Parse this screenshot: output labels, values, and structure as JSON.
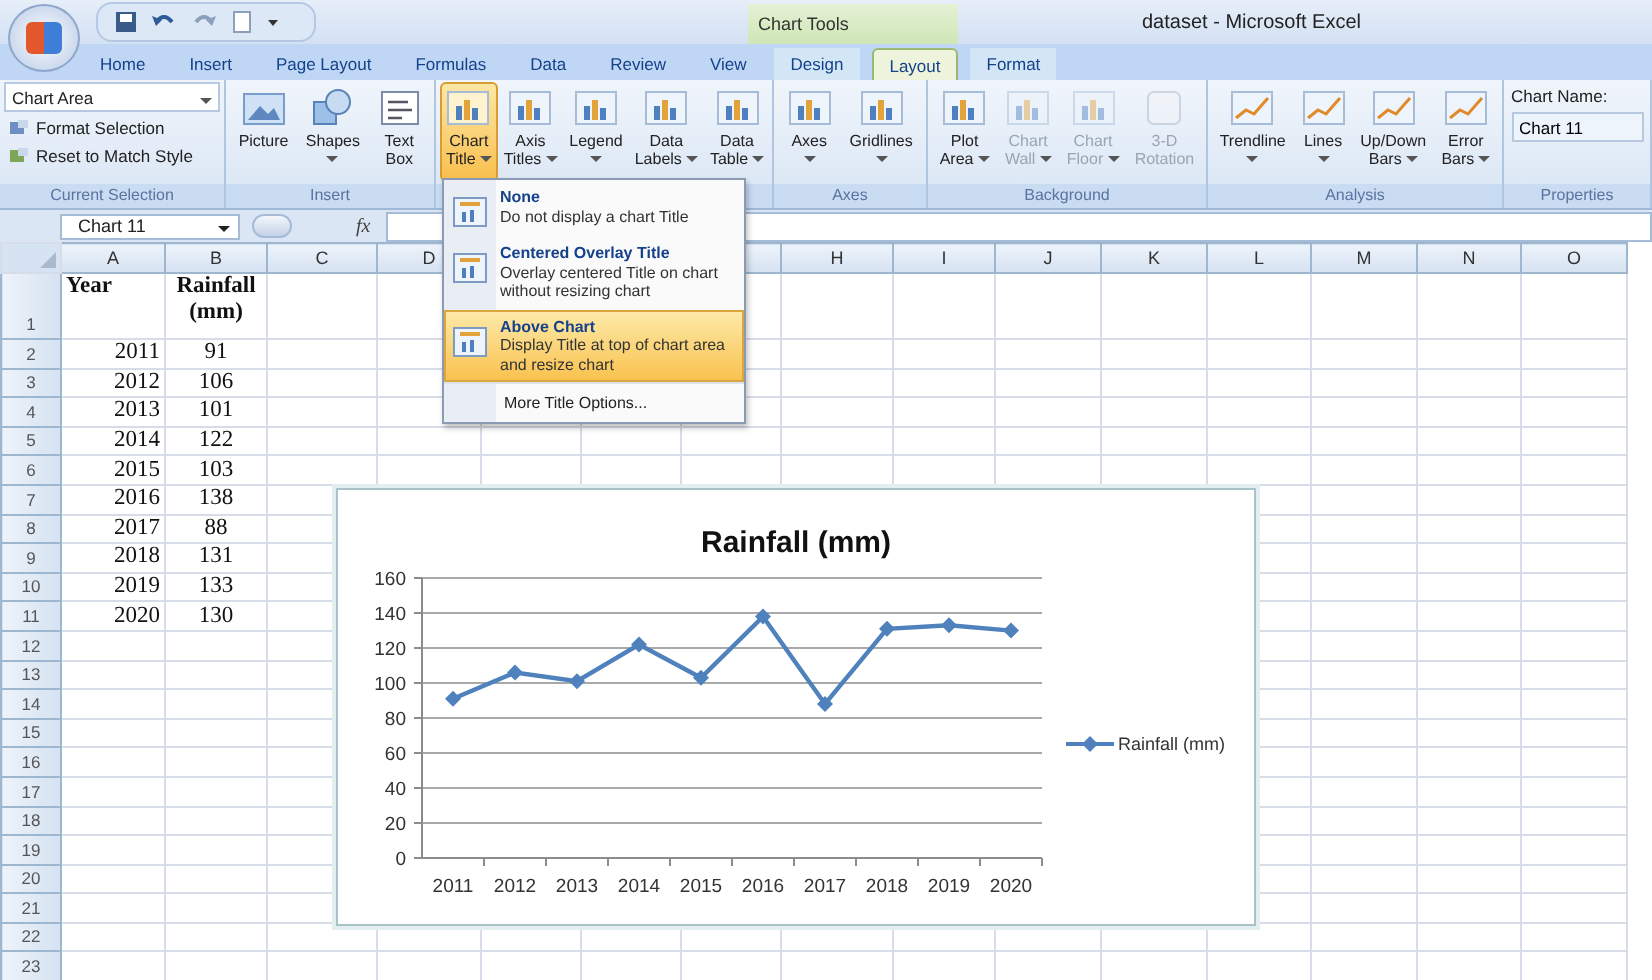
{
  "window": {
    "title": "dataset - Microsoft Excel",
    "context_tab_group": "Chart Tools"
  },
  "tabs": [
    {
      "label": "Home",
      "selected": false
    },
    {
      "label": "Insert",
      "selected": false
    },
    {
      "label": "Page Layout",
      "selected": false
    },
    {
      "label": "Formulas",
      "selected": false
    },
    {
      "label": "Data",
      "selected": false
    },
    {
      "label": "Review",
      "selected": false
    },
    {
      "label": "View",
      "selected": false
    },
    {
      "label": "Design",
      "selected": false
    },
    {
      "label": "Layout",
      "selected": true
    },
    {
      "label": "Format",
      "selected": false
    }
  ],
  "ribbon": {
    "groups": [
      {
        "label": "Current Selection",
        "kind": "selection",
        "dropdown": "Chart Area",
        "commands": [
          "Format Selection",
          "Reset to Match Style"
        ]
      },
      {
        "label": "Insert",
        "kind": "buttons",
        "buttons": [
          {
            "lines": [
              "Picture"
            ],
            "menu": false,
            "disabled": false,
            "expanded": false
          },
          {
            "lines": [
              "Shapes"
            ],
            "menu": true,
            "disabled": false,
            "expanded": false
          },
          {
            "lines": [
              "Text",
              "Box"
            ],
            "menu": false,
            "disabled": false,
            "expanded": false
          }
        ]
      },
      {
        "kind": "buttons",
        "buttons": [
          {
            "lines": [
              "Chart",
              "Title"
            ],
            "menu": true,
            "disabled": false,
            "expanded": true
          },
          {
            "lines": [
              "Axis",
              "Titles"
            ],
            "menu": true,
            "disabled": false,
            "expanded": false
          },
          {
            "lines": [
              "Legend"
            ],
            "menu": true,
            "disabled": false,
            "expanded": false
          },
          {
            "lines": [
              "Data",
              "Labels"
            ],
            "menu": true,
            "disabled": false,
            "expanded": false
          },
          {
            "lines": [
              "Data",
              "Table"
            ],
            "menu": true,
            "disabled": false,
            "expanded": false
          }
        ]
      },
      {
        "label": "Axes",
        "kind": "buttons",
        "buttons": [
          {
            "lines": [
              "Axes"
            ],
            "menu": true,
            "disabled": false,
            "expanded": false
          },
          {
            "lines": [
              "Gridlines"
            ],
            "menu": true,
            "disabled": false,
            "expanded": false
          }
        ]
      },
      {
        "label": "Background",
        "kind": "buttons",
        "buttons": [
          {
            "lines": [
              "Plot",
              "Area"
            ],
            "menu": true,
            "disabled": false,
            "expanded": false
          },
          {
            "lines": [
              "Chart",
              "Wall"
            ],
            "menu": true,
            "disabled": true,
            "expanded": false
          },
          {
            "lines": [
              "Chart",
              "Floor"
            ],
            "menu": true,
            "disabled": true,
            "expanded": false
          },
          {
            "lines": [
              "3-D",
              "Rotation"
            ],
            "menu": false,
            "disabled": true,
            "expanded": false
          }
        ]
      },
      {
        "label": "Analysis",
        "kind": "buttons",
        "buttons": [
          {
            "lines": [
              "Trendline"
            ],
            "menu": true,
            "disabled": false,
            "expanded": false
          },
          {
            "lines": [
              "Lines"
            ],
            "menu": true,
            "disabled": false,
            "expanded": false
          },
          {
            "lines": [
              "Up/Down",
              "Bars"
            ],
            "menu": true,
            "disabled": false,
            "expanded": false
          },
          {
            "lines": [
              "Error",
              "Bars"
            ],
            "menu": true,
            "disabled": false,
            "expanded": false
          }
        ]
      },
      {
        "label": "Properties",
        "kind": "properties",
        "field_label": "Chart Name:",
        "value": "Chart 11"
      }
    ]
  },
  "chart_title_menu": {
    "items": [
      {
        "title": "None",
        "description": "Do not display a chart Title",
        "selected": false
      },
      {
        "title": "Centered Overlay Title",
        "description": "Overlay centered Title on chart without resizing chart",
        "selected": false
      },
      {
        "title": "Above Chart",
        "description": "Display Title at top of chart area and resize chart",
        "selected": true
      }
    ],
    "more": "More Title Options..."
  },
  "formula_bar": {
    "name_box": "Chart 11",
    "function_label": "fx"
  },
  "sheet": {
    "columns": [
      "A",
      "B",
      "C",
      "D",
      null,
      null,
      null,
      "H",
      "I",
      "J",
      "K",
      "L",
      "M",
      "N",
      "O"
    ],
    "rows": [
      {
        "number": "1",
        "cells": [
          "Year",
          "Rainfall (mm)"
        ]
      },
      {
        "number": "2",
        "cells": [
          "2011",
          "91"
        ]
      },
      {
        "number": "3",
        "cells": [
          "2012",
          "106"
        ]
      },
      {
        "number": "4",
        "cells": [
          "2013",
          "101"
        ]
      },
      {
        "number": "5",
        "cells": [
          "2014",
          "122"
        ]
      },
      {
        "number": "6",
        "cells": [
          "2015",
          "103"
        ]
      },
      {
        "number": "7",
        "cells": [
          "2016",
          "138"
        ]
      },
      {
        "number": "8",
        "cells": [
          "2017",
          "88"
        ]
      },
      {
        "number": "9",
        "cells": [
          "2018",
          "131"
        ]
      },
      {
        "number": "10",
        "cells": [
          "2019",
          "133"
        ]
      },
      {
        "number": "11",
        "cells": [
          "2020",
          "130"
        ]
      },
      {
        "number": "12"
      },
      {
        "number": "13"
      },
      {
        "number": "14"
      },
      {
        "number": "15"
      },
      {
        "number": "16"
      },
      {
        "number": "17"
      },
      {
        "number": "18"
      },
      {
        "number": "19"
      },
      {
        "number": "20"
      },
      {
        "number": "21"
      },
      {
        "number": "22"
      },
      {
        "number": "23"
      }
    ]
  },
  "chart": {
    "chart_data": {
      "type": "line",
      "title": "Rainfall (mm)",
      "categories": [
        "2011",
        "2012",
        "2013",
        "2014",
        "2015",
        "2016",
        "2017",
        "2018",
        "2019",
        "2020"
      ],
      "grid": true,
      "series": [
        {
          "name": "Rainfall (mm)",
          "color": "#4f81bd",
          "marker": "diamond",
          "values": [
            91,
            106,
            101,
            122,
            103,
            138,
            88,
            131,
            133,
            130
          ]
        }
      ],
      "ylim": [
        0,
        160
      ],
      "yticks": [
        0,
        20,
        40,
        60,
        80,
        100,
        120,
        140,
        160
      ]
    }
  }
}
